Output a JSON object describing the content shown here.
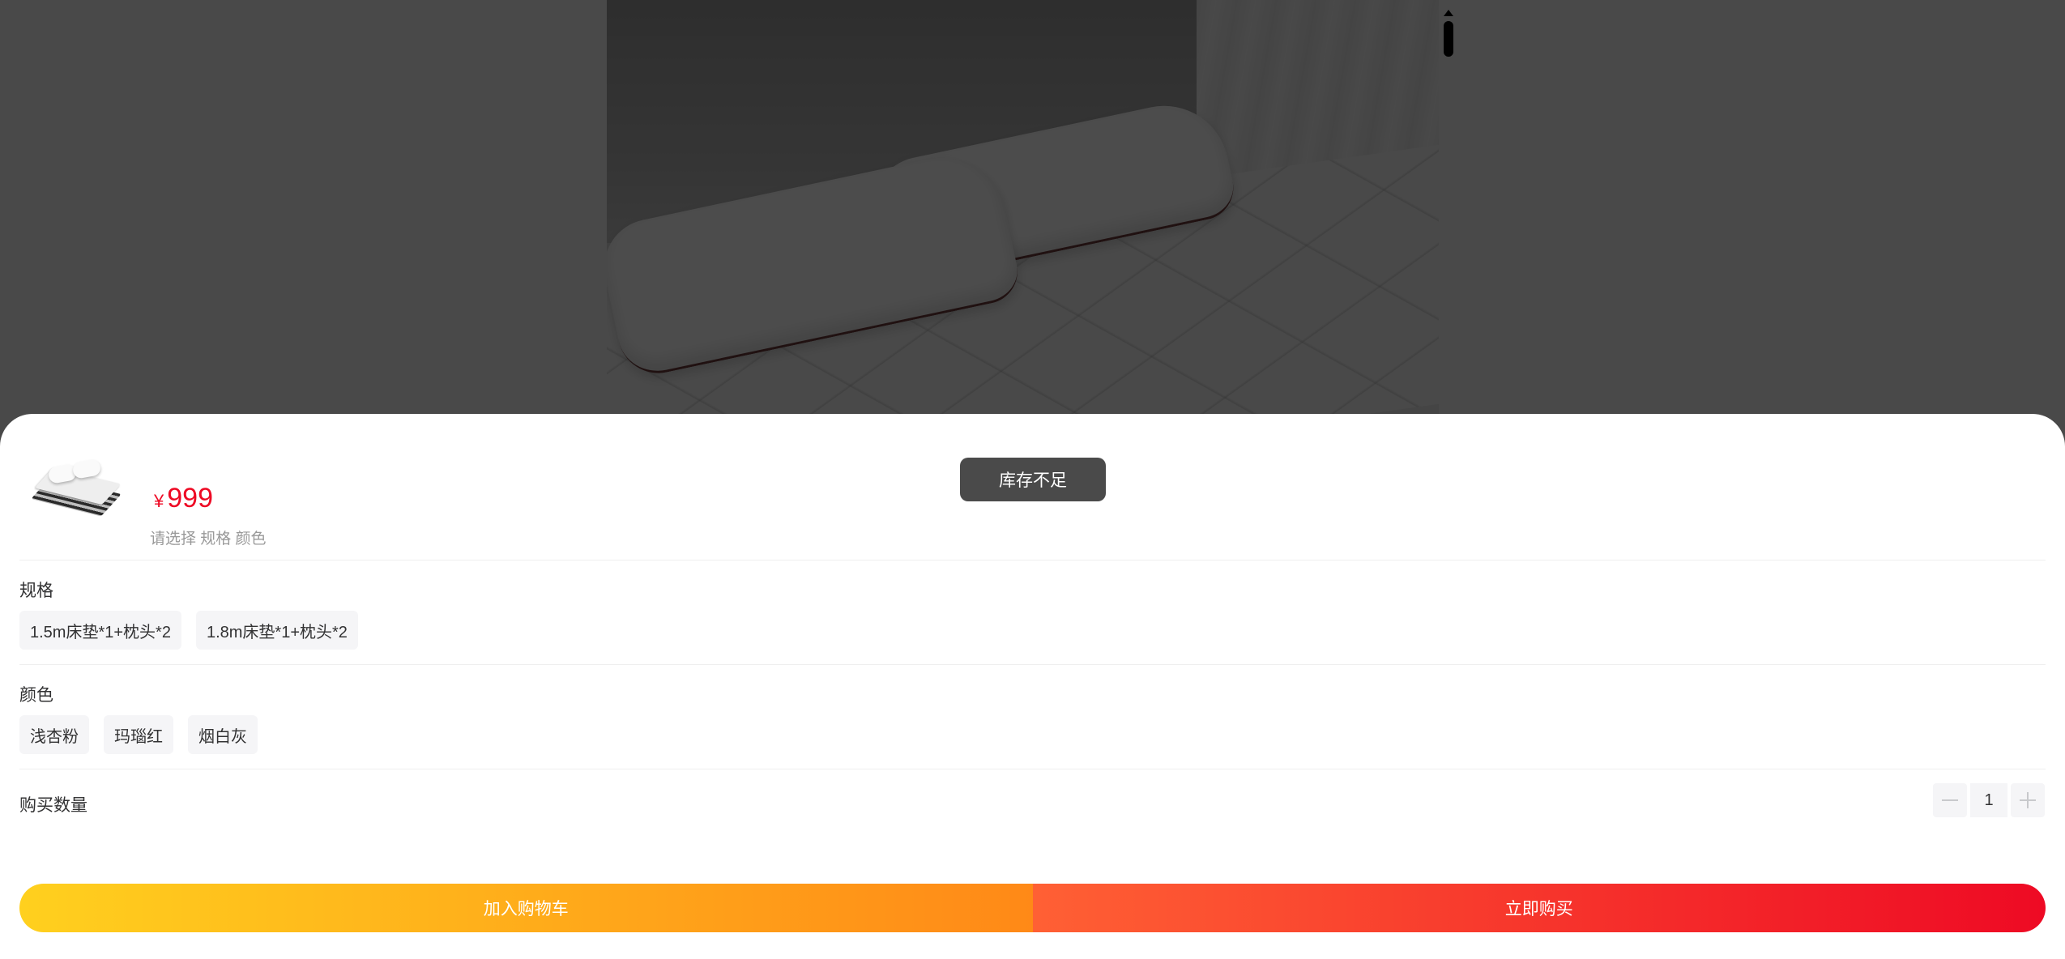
{
  "sku_popup": {
    "price": {
      "currency": "¥",
      "amount": "999"
    },
    "select_hint": "请选择 规格 颜色",
    "toast": "库存不足",
    "spec": {
      "title": "规格",
      "options": [
        "1.5m床垫*1+枕头*2",
        "1.8m床垫*1+枕头*2"
      ]
    },
    "color": {
      "title": "颜色",
      "options": [
        "浅杏粉",
        "玛瑙红",
        "烟白灰"
      ]
    },
    "quantity": {
      "label": "购买数量",
      "value": "1"
    },
    "actions": {
      "add_to_cart": "加入购物车",
      "buy_now": "立即购买"
    }
  },
  "colors": {
    "price": "#ee0a24",
    "cart_gradient": [
      "#ffd01e",
      "#ff8917"
    ],
    "buy_gradient": [
      "#ff6034",
      "#ee0a24"
    ]
  },
  "icons": {
    "product_photo": "bed-mattress-with-pillows",
    "thumbnail": "mattress-thumbnail",
    "minus": "minus-icon",
    "plus": "plus-icon"
  }
}
